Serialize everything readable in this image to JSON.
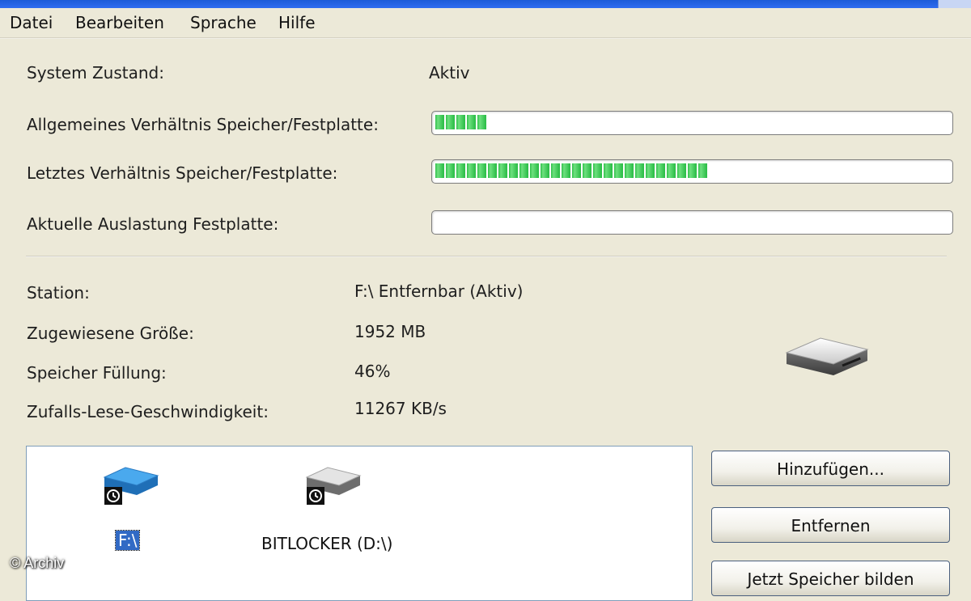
{
  "menu": [
    "Datei",
    "Bearbeiten",
    "Sprache",
    "Hilfe"
  ],
  "status": {
    "system_label": "System Zustand:",
    "system_value": "Aktiv",
    "ratio_general_label": "Allgemeines Verhältnis Speicher/Festplatte:",
    "ratio_general_fraction": 0.11,
    "ratio_last_label": "Letztes Verhältnis Speicher/Festplatte:",
    "ratio_last_fraction": 0.53,
    "disk_load_label": "Aktuelle Auslastung Festplatte:",
    "disk_load_fraction": 0.0,
    "progress_color": "#2fbf4a"
  },
  "details": {
    "station_label": "Station:",
    "station_value": "F:\\ Entfernbar (Aktiv)",
    "size_label": "Zugewiesene Größe:",
    "size_value": "1952 MB",
    "fill_label": "Speicher Füllung:",
    "fill_value": "46%",
    "speed_label": "Zufalls-Lese-Geschwindigkeit:",
    "speed_value": "11267 KB/s",
    "icon": "removable-drive-icon"
  },
  "drives": [
    {
      "label": "F:\\",
      "icon": "usb-drive-icon",
      "selected": true,
      "color": "#2f8fd8"
    },
    {
      "label": "BITLOCKER (D:\\)",
      "icon": "hard-drive-icon",
      "selected": false,
      "color": "#9a9a9a"
    }
  ],
  "buttons": {
    "add": "Hinzufügen...",
    "remove": "Entfernen",
    "build": "Jetzt Speicher bilden"
  },
  "watermark": "© Archiv"
}
